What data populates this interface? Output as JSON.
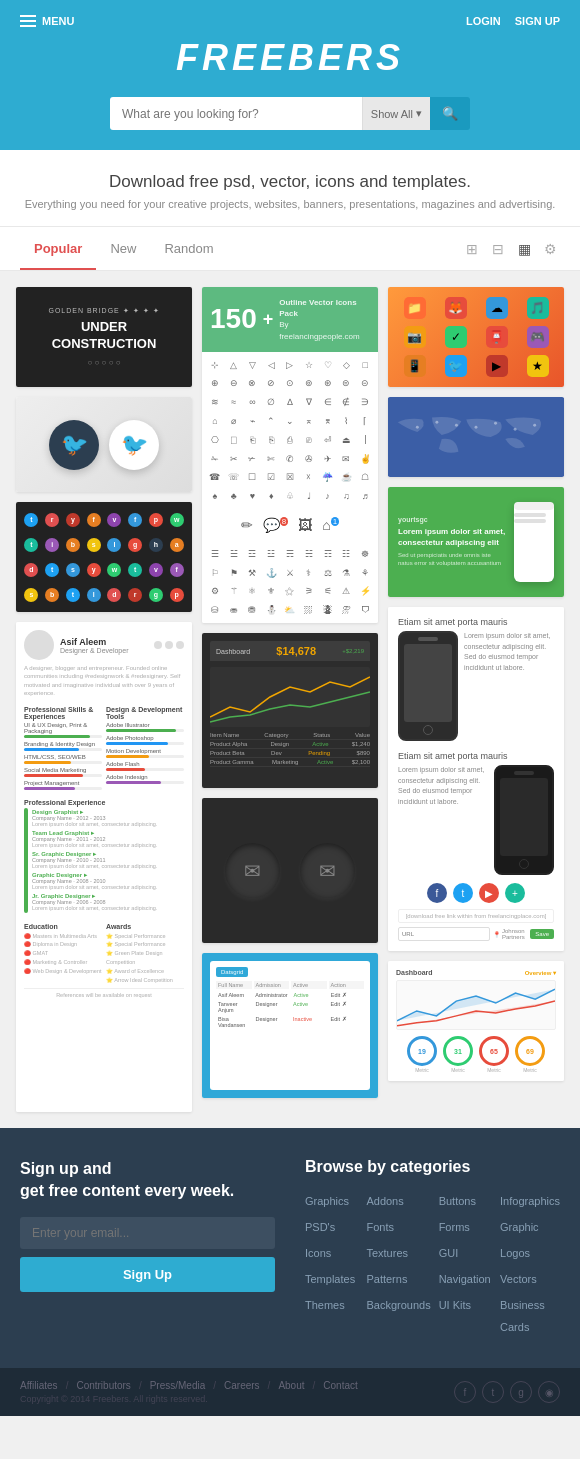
{
  "header": {
    "menu_label": "MENU",
    "login_label": "LOGIN",
    "signup_label": "SIGN UP",
    "site_title": "FREEBERS",
    "search_placeholder": "What are you looking for?",
    "search_dropdown_label": "Show All",
    "hero_title": "Download free psd, vector, icons and templates.",
    "hero_subtitle": "Everything you need for your creative projects, websites, banners, presentations, magazines and advertising."
  },
  "tabs": {
    "items": [
      {
        "label": "Popular",
        "active": true
      },
      {
        "label": "New",
        "active": false
      },
      {
        "label": "Random",
        "active": false
      }
    ]
  },
  "cards": {
    "under_construction": {
      "tag": "GOLDEN BRIDGE",
      "title": "UNDER\nCONSTRUCTION"
    },
    "vector_icons": {
      "number": "150+",
      "label": "Outline Vector Icons Pack",
      "author": "By freelancingpeople.com"
    },
    "signup": {
      "title": "Sign up and\nget free content every week.",
      "email_placeholder": "Enter your email...",
      "button_label": "Sign Up"
    },
    "categories": {
      "title": "Browse by categories",
      "items": [
        "Graphics",
        "Addons",
        "Buttons",
        "Infographics",
        "PSD's",
        "Fonts",
        "Forms",
        "Graphic",
        "Icons",
        "Textures",
        "GUI",
        "Logos",
        "Templates",
        "Patterns",
        "Navigation",
        "Vectors",
        "Themes",
        "Backgrounds",
        "UI Kits",
        "Business Cards"
      ]
    }
  },
  "footer": {
    "links": [
      "Affiliates",
      "Contributors",
      "Press/Media",
      "Careers",
      "About",
      "Contact"
    ],
    "copyright": "Copyright © 2014 Freebers. All rights reserved.",
    "social_icons": [
      "f",
      "t",
      "g+",
      "rss"
    ]
  }
}
